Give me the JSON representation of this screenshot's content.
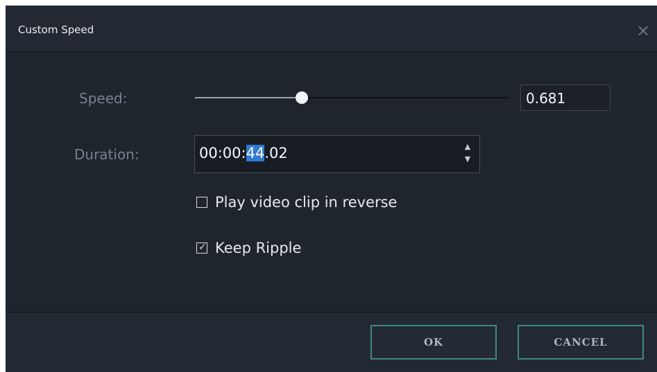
{
  "dialog": {
    "title": "Custom Speed",
    "close_icon": "×"
  },
  "speed": {
    "label": "Speed:",
    "value": "0.681",
    "slider_fraction": 0.34
  },
  "duration": {
    "label": "Duration:",
    "prefix": "00:00:",
    "selected": "44",
    "suffix": ".02",
    "spin_up_icon": "▲",
    "spin_down_icon": "▼"
  },
  "options": [
    {
      "label": "Play video clip in reverse",
      "checked": false
    },
    {
      "label": "Keep Ripple",
      "checked": true,
      "check_icon": "✓"
    }
  ],
  "buttons": {
    "ok": "OK",
    "cancel": "CANCEL"
  },
  "colors": {
    "accent": "#3d8a7f",
    "selection": "#2e7ad6"
  }
}
